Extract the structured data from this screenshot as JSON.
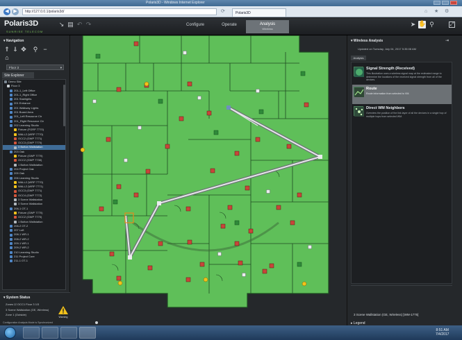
{
  "browser": {
    "window_title": "Polaris3D - Windows Internet Explorer",
    "url": "http://127.0.0.1/polaris3d/",
    "tab_label": "Polaris3D",
    "nav_back": "◀",
    "nav_forward": "▶"
  },
  "app": {
    "logo": "Polaris3D",
    "logo_sub": "SUNRISE TELECOM",
    "modes": [
      "Configure",
      "Operate",
      "Analysis"
    ],
    "mode_active_sub": "Wireless"
  },
  "navigation": {
    "title": "Navigation",
    "floor_select": "Floor 3"
  },
  "site_explorer": {
    "tab": "Site Explorer",
    "items": [
      {
        "label": "Demo Site",
        "icon": "building"
      },
      {
        "label": "Floor 3",
        "icon": "floor"
      },
      {
        "label": "201-1_Left Office",
        "icon": "room"
      },
      {
        "label": "201-1_Right Office",
        "icon": "room"
      },
      {
        "label": "201 Stairlights",
        "icon": "room"
      },
      {
        "label": "201 Entrance",
        "icon": "room"
      },
      {
        "label": "201 Walkway Lights",
        "icon": "room"
      },
      {
        "label": "201 Board Area",
        "icon": "room"
      },
      {
        "label": "201_Left Resource Ctr",
        "icon": "room"
      },
      {
        "label": "201_Right Resource Ctr",
        "icon": "room"
      },
      {
        "label": "202 Learning Studio",
        "icon": "room"
      },
      {
        "label": "Fixture (FGRP 7770)",
        "icon": "fixture"
      },
      {
        "label": "WALL2 (WRP 7770)",
        "icon": "fixture"
      },
      {
        "label": "OCC2 (GWP 7771)",
        "icon": "sensor"
      },
      {
        "label": "OCC3 (GWP 7770)",
        "icon": "sensor"
      },
      {
        "label": "3 Button Wallstation",
        "icon": "switch"
      },
      {
        "label": "203 Oak",
        "icon": "room"
      },
      {
        "label": "Fixture (GWP 7770)",
        "icon": "fixture"
      },
      {
        "label": "OCC2 (GWP 7730)",
        "icon": "sensor"
      },
      {
        "label": "1 Button Wallstation",
        "icon": "switch"
      },
      {
        "label": "204 Project Oak",
        "icon": "room"
      },
      {
        "label": "205 Oak",
        "icon": "room"
      },
      {
        "label": "206 Learning Studio",
        "icon": "room"
      },
      {
        "label": "WALL2 (WRP 7770)",
        "icon": "fixture"
      },
      {
        "label": "WALL2 (WRP 7771)",
        "icon": "fixture"
      },
      {
        "label": "OCC3 (GWP 7771)",
        "icon": "sensor"
      },
      {
        "label": "OCC4 (GWP 7772)",
        "icon": "sensor"
      },
      {
        "label": "3 Scene Wallstation",
        "icon": "switch"
      },
      {
        "label": "3 Scene Wallstation",
        "icon": "switch"
      },
      {
        "label": "206-1 OT-1",
        "icon": "room"
      },
      {
        "label": "Fixture (GWP 7770)",
        "icon": "fixture"
      },
      {
        "label": "OCC2 (GWP 7770)",
        "icon": "sensor"
      },
      {
        "label": "1 Button Wallstation",
        "icon": "switch"
      },
      {
        "label": "206-2 OT-2",
        "icon": "room"
      },
      {
        "label": "207 Loft",
        "icon": "room"
      },
      {
        "label": "208-1 WR-1",
        "icon": "room"
      },
      {
        "label": "208-2 WR-2",
        "icon": "room"
      },
      {
        "label": "209-1 WR-1",
        "icon": "room"
      },
      {
        "label": "209-2 WR-2",
        "icon": "room"
      },
      {
        "label": "210 Learning Studio",
        "icon": "room"
      },
      {
        "label": "211 Project Core",
        "icon": "room"
      },
      {
        "label": "211-1 OT-1",
        "icon": "room"
      }
    ]
  },
  "system_status": {
    "title": "System Status",
    "line1": "Zones  ☑  OCC1 Floor 3 1/3",
    "line2": "3 Scene Wallstation (GE, Wireless)",
    "line3": "Zone 1 (Outside)",
    "footer": "Configuration Analysis Mode is Synchronized",
    "warn_label": "Warning"
  },
  "wireless_analysis": {
    "title": "Wireless Analysis",
    "updated": "Updated on Tuesday, July 04, 2017 5:35:08 AM",
    "tab": "Analysis",
    "items": [
      {
        "title": "Signal Strength (Received)",
        "desc": "This illustration uses a wireless signal map at the estimated range to determine the locations of the received signal strength from all of the devices.",
        "selected": false
      },
      {
        "title": "Route",
        "desc": "Route information from selected to VM.",
        "selected": true
      },
      {
        "title": "Direct WM Neighbors",
        "desc": "Overview the position of the link layer of all the devices in a single hop of multiple hops from selected WM.",
        "selected": false
      }
    ],
    "footer": "3 Scene Wallstation (GE, Wireless) [WM-1775]",
    "legend": "Legend"
  },
  "taskbar": {
    "time": "8:51 AM",
    "date": "7/4/2017"
  },
  "colors": {
    "map_green": "#5fbf59",
    "map_lines": "#1f4a22",
    "route": "#e6e8ea",
    "selected_device": "#e38a1c"
  }
}
